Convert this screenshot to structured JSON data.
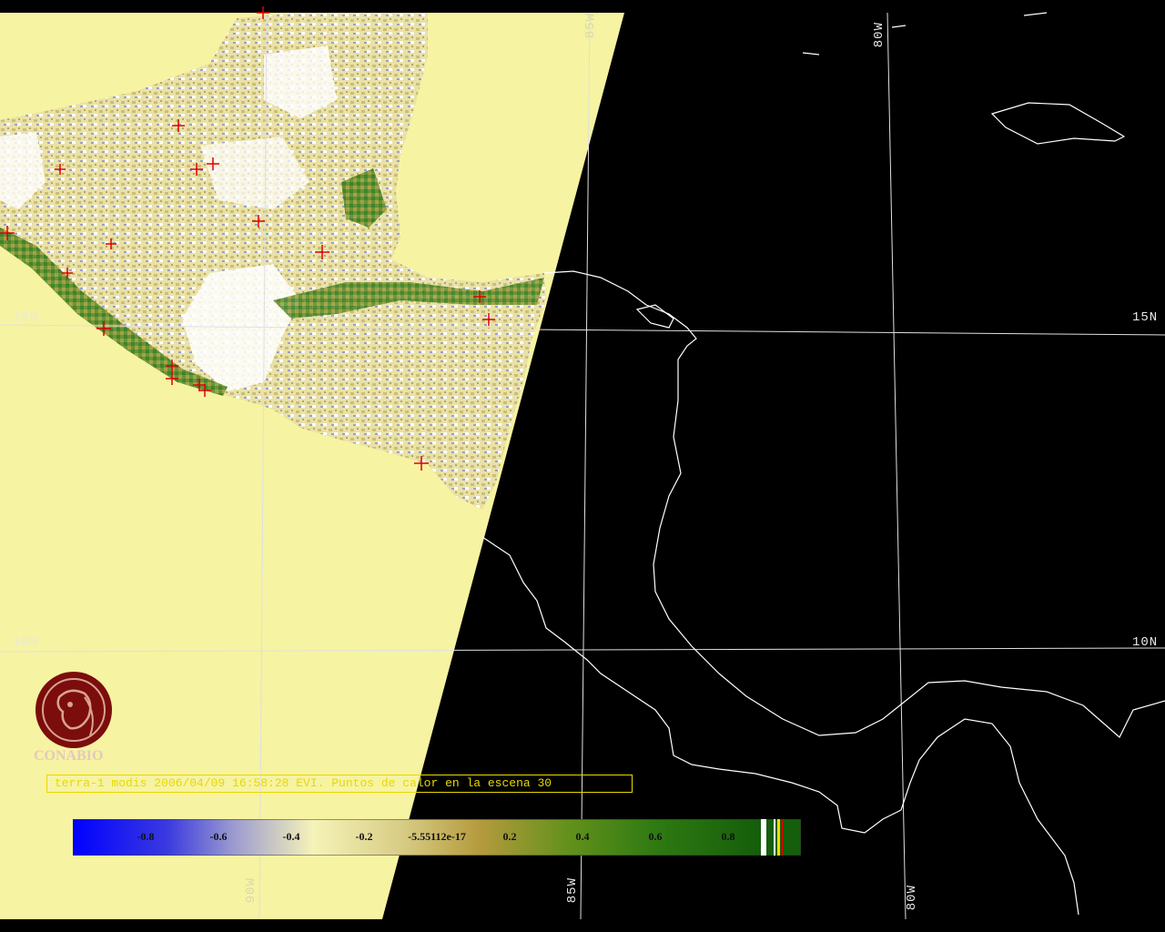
{
  "map": {
    "latitude_labels": {
      "north15": "15N",
      "north10": "10N"
    },
    "longitude_labels": {
      "west90": "90W",
      "west85": "85W",
      "west80": "80W"
    },
    "hotspot_count": 30
  },
  "caption": {
    "text": "terra-1 modis 2006/04/09 16:58:28 EVI. Puntos de calor en la escena 30",
    "color": "#e8d800"
  },
  "colorbar": {
    "ticks": [
      "-0.8",
      "-0.6",
      "-0.4",
      "-0.2",
      "-5.55112e-17",
      "0.2",
      "0.4",
      "0.6",
      "0.8"
    ],
    "colors": {
      "low": "#0000ff",
      "mid": "#f6f3b8",
      "high": "#165f0c"
    }
  },
  "logo": {
    "name": "CONABIO",
    "color": "#7b0d0d"
  },
  "colors": {
    "swath_background": "#f6f3a2",
    "hotspot": "#e00000",
    "land_white": "#ffffff"
  }
}
